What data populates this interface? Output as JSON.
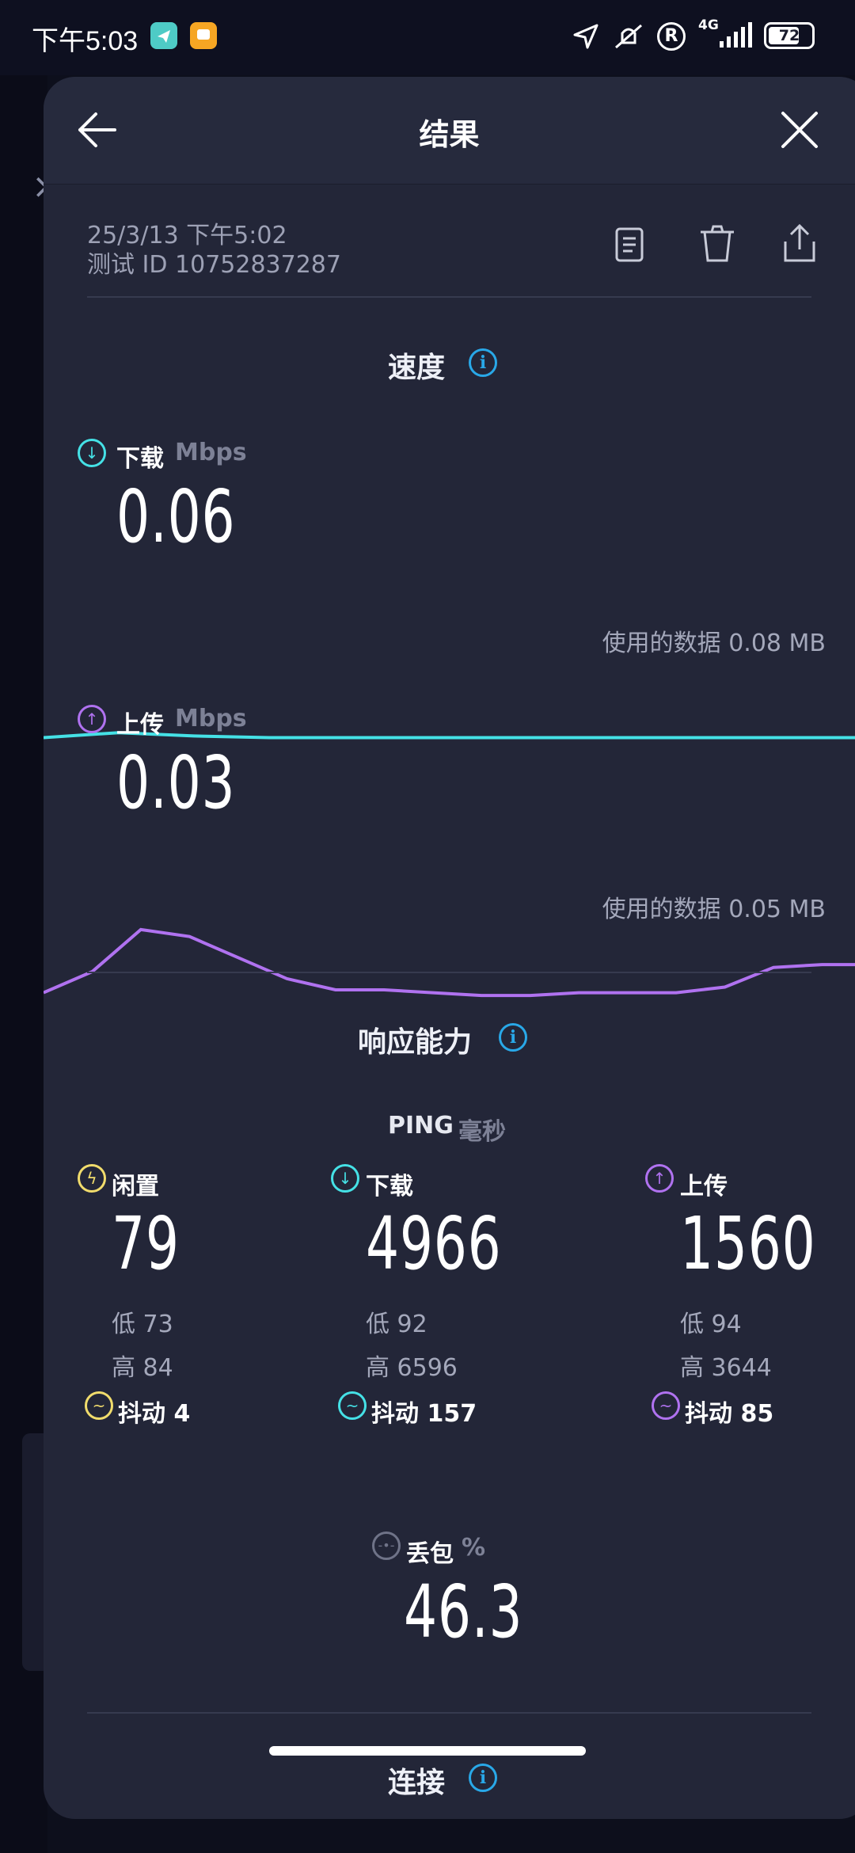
{
  "status_bar": {
    "time": "下午5:03",
    "network": "4G",
    "battery": "72",
    "ring": "R"
  },
  "header": {
    "title": "结果"
  },
  "meta": {
    "datetime": "25/3/13 下午5:02",
    "test_id": "测试 ID 10752837287"
  },
  "speed": {
    "title": "速度",
    "download": {
      "label": "下载",
      "unit": "Mbps",
      "value": "0.06",
      "data_used": "使用的数据 0.08 MB",
      "trace": [
        0.13,
        0.16,
        0.14,
        0.13,
        0.13,
        0.13,
        0.13,
        0.13,
        0.13,
        0.13,
        0.13,
        0.13
      ],
      "color": "#45e1e6"
    },
    "upload": {
      "label": "上传",
      "unit": "Mbps",
      "value": "0.03",
      "data_used": "使用的数据 0.05 MB",
      "trace": [
        0.02,
        0.035,
        0.065,
        0.06,
        0.045,
        0.03,
        0.022,
        0.022,
        0.02,
        0.018,
        0.018,
        0.02,
        0.02,
        0.02,
        0.024,
        0.038,
        0.04,
        0.04
      ],
      "color": "#b072f0"
    }
  },
  "responsiveness": {
    "title": "响应能力",
    "ping_heading": "PING",
    "ping_unit": "毫秒",
    "idle": {
      "label": "闲置",
      "value": "79",
      "low": "低 73",
      "high": "高 84",
      "jitter": "抖动 4",
      "color": "#f1dc6c"
    },
    "download": {
      "label": "下载",
      "value": "4966",
      "low": "低 92",
      "high": "高 6596",
      "jitter": "抖动 157",
      "color": "#45e1e6"
    },
    "upload": {
      "label": "上传",
      "value": "1560",
      "low": "低 94",
      "high": "高 3644",
      "jitter": "抖动 85",
      "color": "#b072f0"
    },
    "packet_loss": {
      "label": "丢包",
      "unit": "%",
      "value": "46.3"
    }
  },
  "connection": {
    "title": "连接"
  },
  "icons": [
    "back-arrow-icon",
    "close-icon",
    "document-icon",
    "trash-icon",
    "share-icon",
    "info-icon",
    "download-icon",
    "upload-icon",
    "idle-icon",
    "jitter-icon",
    "packet-loss-icon"
  ]
}
